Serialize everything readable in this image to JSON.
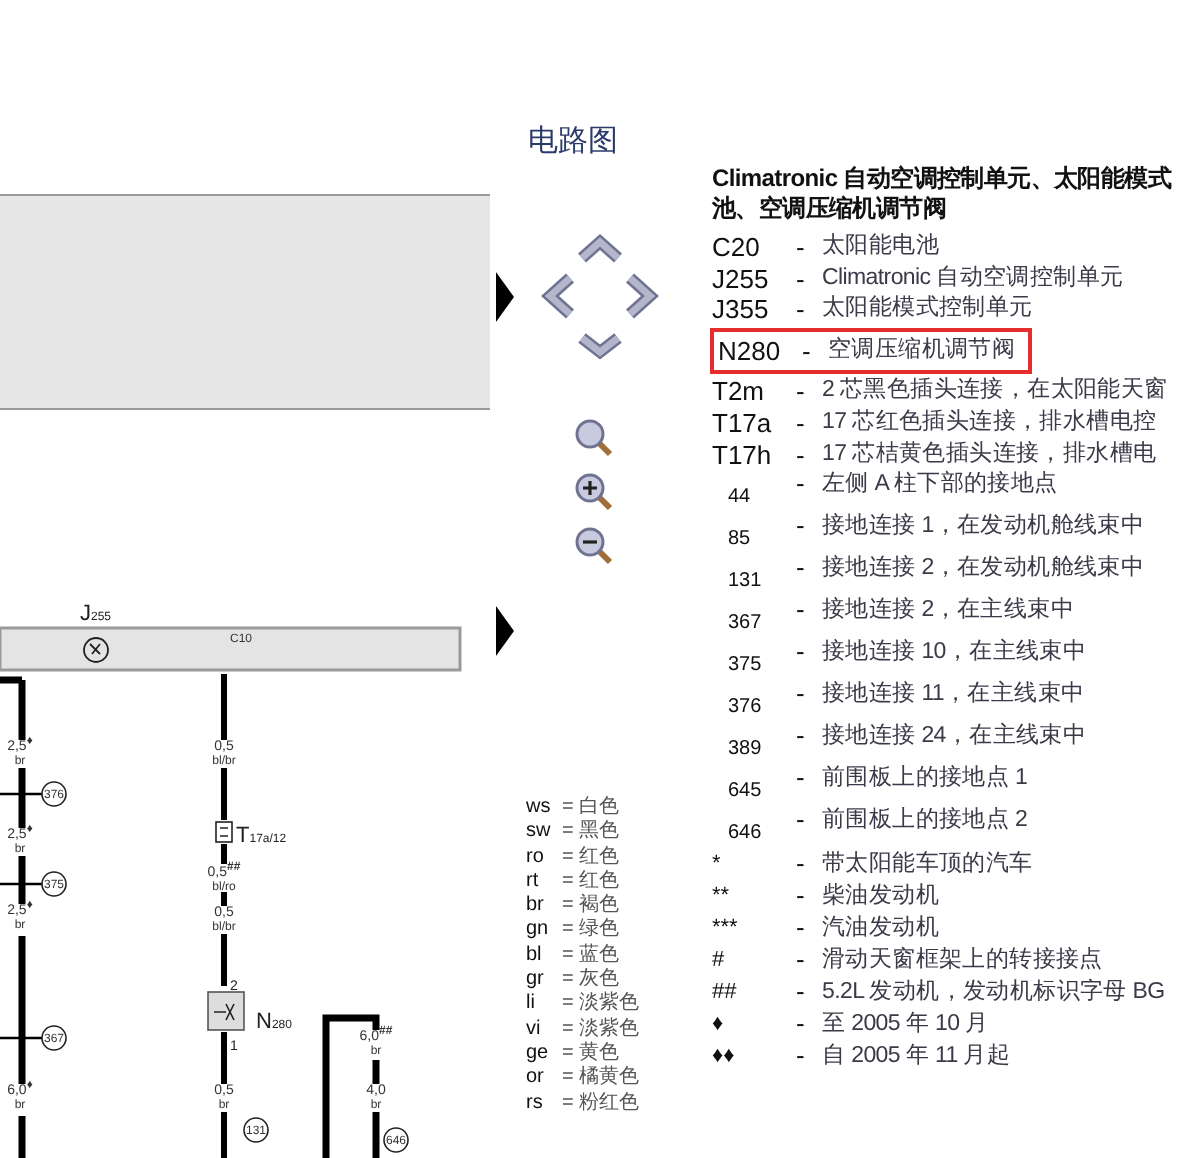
{
  "title": "电路图",
  "diagram": {
    "unit": {
      "letter": "J",
      "index": "255"
    },
    "pin": "C10",
    "connector": {
      "letter": "T",
      "index": "17a/12"
    },
    "valve": {
      "letter": "N",
      "index": "280"
    },
    "valve_pins": [
      "2",
      "1"
    ],
    "wire_labels": [
      {
        "size": "2,5",
        "mark": "♦",
        "insulation": "br"
      },
      {
        "size": "2,5",
        "mark": "♦",
        "insulation": "br"
      },
      {
        "size": "2,5",
        "mark": "♦",
        "insulation": "br"
      },
      {
        "size": "6,0",
        "mark": "♦",
        "insulation": "br"
      },
      {
        "size": "0,5",
        "insulation": "bl/br"
      },
      {
        "size": "0,5",
        "mark": "##",
        "insulation": "bl/ro"
      },
      {
        "size": "0,5",
        "insulation": "bl/br"
      },
      {
        "size": "0,5",
        "insulation": "br"
      },
      {
        "size": "6,0",
        "mark": "##",
        "insulation": "br"
      },
      {
        "size": "4,0",
        "insulation": "br"
      }
    ],
    "ground_points": [
      "376",
      "375",
      "367",
      "131",
      "646"
    ]
  },
  "color_codes": [
    {
      "code": "ws",
      "text": "= 白色"
    },
    {
      "code": "sw",
      "text": "= 黑色"
    },
    {
      "code": "ro",
      "text": "= 红色"
    },
    {
      "code": "rt",
      "text": "= 红色"
    },
    {
      "code": "br",
      "text": "= 褐色"
    },
    {
      "code": "gn",
      "text": "= 绿色"
    },
    {
      "code": "bl",
      "text": "= 蓝色"
    },
    {
      "code": "gr",
      "text": "= 灰色"
    },
    {
      "code": "li",
      "text": "= 淡紫色"
    },
    {
      "code": "vi",
      "text": "= 淡紫色"
    },
    {
      "code": "ge",
      "text": "= 黄色"
    },
    {
      "code": "or",
      "text": "= 橘黄色"
    },
    {
      "code": "rs",
      "text": "= 粉红色"
    }
  ],
  "legend": {
    "heading_lines": [
      "Climatronic 自动空调控制单元、太阳能模式",
      "池、空调压缩机调节阀"
    ],
    "items": [
      {
        "kind": "component",
        "code": "C20",
        "sep": "-",
        "text": "太阳能电池",
        "selected": false
      },
      {
        "kind": "component",
        "code": "J255",
        "sep": "-",
        "text": "Climatronic 自动空调控制单元",
        "selected": false
      },
      {
        "kind": "component",
        "code": "J355",
        "sep": "-",
        "text": "太阳能模式控制单元",
        "selected": false
      },
      {
        "kind": "component",
        "code": "N280",
        "sep": "-",
        "text": "空调压缩机调节阀",
        "selected": true
      },
      {
        "kind": "component",
        "code": "T2m",
        "sep": "-",
        "text": "2 芯黑色插头连接，在太阳能天窗",
        "selected": false
      },
      {
        "kind": "component",
        "code": "T17a",
        "sep": "-",
        "text": "17 芯红色插头连接，排水槽电控",
        "selected": false
      },
      {
        "kind": "component",
        "code": "T17h",
        "sep": "-",
        "text": "17 芯桔黄色插头连接，排水槽电",
        "selected": false
      },
      {
        "kind": "ground",
        "code": "44",
        "sep": "-",
        "text": "左侧 A 柱下部的接地点",
        "selected": false
      },
      {
        "kind": "ground",
        "code": "85",
        "sep": "-",
        "text": "接地连接 1，在发动机舱线束中",
        "selected": false
      },
      {
        "kind": "ground",
        "code": "131",
        "sep": "-",
        "text": "接地连接 2，在发动机舱线束中",
        "selected": false
      },
      {
        "kind": "ground",
        "code": "367",
        "sep": "-",
        "text": "接地连接 2，在主线束中",
        "selected": false
      },
      {
        "kind": "ground",
        "code": "375",
        "sep": "-",
        "text": "接地连接 10，在主线束中",
        "selected": false
      },
      {
        "kind": "ground",
        "code": "376",
        "sep": "-",
        "text": "接地连接 11，在主线束中",
        "selected": false
      },
      {
        "kind": "ground",
        "code": "389",
        "sep": "-",
        "text": "接地连接 24，在主线束中",
        "selected": false
      },
      {
        "kind": "ground",
        "code": "645",
        "sep": "-",
        "text": "前围板上的接地点 1",
        "selected": false
      },
      {
        "kind": "ground",
        "code": "646",
        "sep": "-",
        "text": "前围板上的接地点 2",
        "selected": false
      },
      {
        "kind": "note",
        "code": "*",
        "sep": "-",
        "text": "带太阳能车顶的汽车",
        "selected": false
      },
      {
        "kind": "note",
        "code": "**",
        "sep": "-",
        "text": "柴油发动机",
        "selected": false
      },
      {
        "kind": "note",
        "code": "***",
        "sep": "-",
        "text": "汽油发动机",
        "selected": false
      },
      {
        "kind": "note",
        "code": "#",
        "sep": "-",
        "text": "滑动天窗框架上的转接接点",
        "selected": false
      },
      {
        "kind": "note",
        "code": "##",
        "sep": "-",
        "text": "5.2L 发动机，发动机标识字母 BG",
        "selected": false
      },
      {
        "kind": "note",
        "code": "♦",
        "sep": "-",
        "text": "至 2005 年 10 月",
        "selected": false
      },
      {
        "kind": "note",
        "code": "♦♦",
        "sep": "-",
        "text": "自 2005 年 11 月起",
        "selected": false
      }
    ]
  }
}
